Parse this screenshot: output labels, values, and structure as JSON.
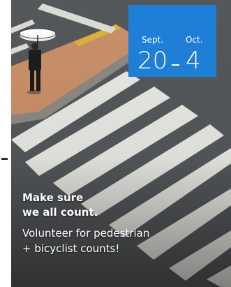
{
  "date_range": {
    "start_month": "Sept.",
    "start_day": "20",
    "end_month": "Oct.",
    "end_day": "4",
    "separator": "–"
  },
  "headline": {
    "line1": "Make sure",
    "line2": "we all count."
  },
  "subline": {
    "line1": "Volunteer for pedestrian",
    "line2": "+ bicyclist counts!"
  },
  "colors": {
    "accent": "#1f7fd6",
    "text": "#ffffff",
    "road": "#4f5255",
    "sidewalk": "#c9906a",
    "crosswalk": "#e8e8e4"
  }
}
